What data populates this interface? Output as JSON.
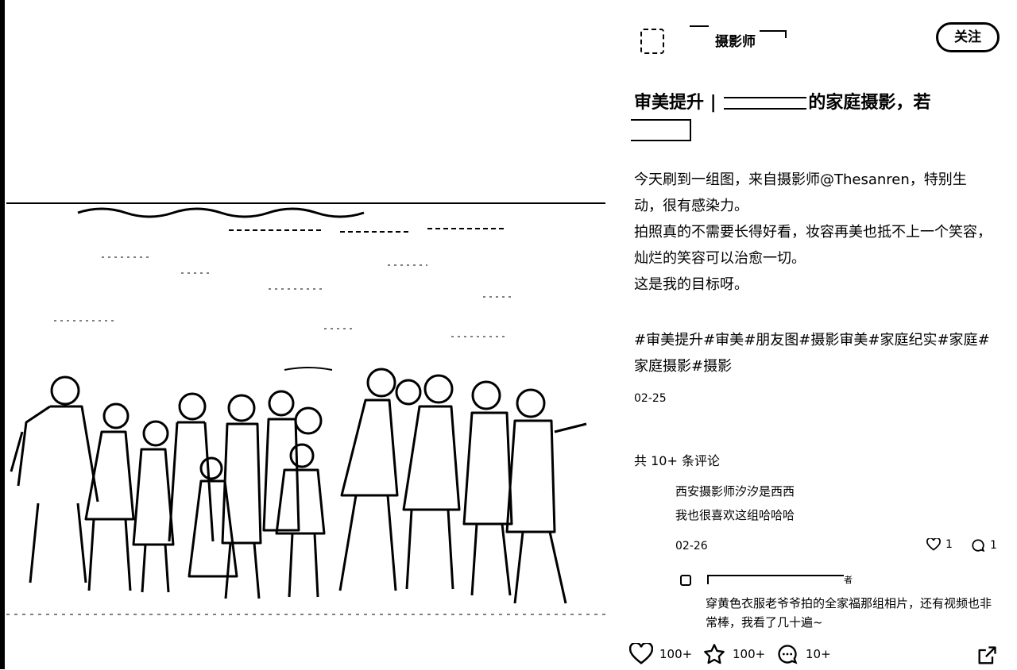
{
  "author": {
    "name": "摄影师",
    "follow_label": "关注"
  },
  "post": {
    "title": "审美提升 | ",
    "title_rest": "的家庭摄影，若",
    "description": [
      "今天刷到一组图，来自摄影师@Thesanren，特别生动，很有感染力。",
      "拍照真的不需要长得好看，妆容再美也抵不上一个笑容，灿烂的笑容可以治愈一切。",
      "这是我的目标呀。"
    ],
    "tags": [
      "#审美提升",
      "#审美",
      "#朋友图",
      "#摄影审美",
      "#家庭纪实",
      "#家庭",
      "#家庭摄影",
      "#摄影"
    ],
    "date": "02-25"
  },
  "comments": {
    "count_label": "共 10+ 条评论",
    "items": [
      {
        "user": "西安摄影师汐汐是西西",
        "text": "我也很喜欢这组哈哈哈",
        "date": "02-26",
        "likes": "1",
        "replies": "1",
        "reply": {
          "tag": "者",
          "text": "穿黄色衣服老爷爷拍的全家福那组相片，还有视频也非常棒，我看了几十遍~"
        }
      }
    ]
  },
  "actions": {
    "likes": "100+",
    "collects": "100+",
    "comments": "10+"
  },
  "icons": [
    "heart-icon",
    "star-icon",
    "comment-bubble-icon",
    "share-icon"
  ]
}
